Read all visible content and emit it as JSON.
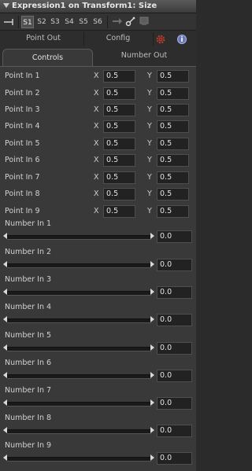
{
  "title": "Expression1 on Transform1: Size",
  "toolbar": {
    "slots": [
      "S1",
      "S2",
      "S3",
      "S4",
      "S5",
      "S6"
    ],
    "active_slot": "S1"
  },
  "tabs": {
    "top": [
      "Point Out",
      "Config"
    ],
    "sub": [
      "Controls",
      "Number Out"
    ]
  },
  "icons": {
    "gear": "gear-icon",
    "info": "info-icon",
    "info_glyph": "i"
  },
  "points": [
    {
      "label": "Point In 1",
      "x_label": "X",
      "x": "0.5",
      "y_label": "Y",
      "y": "0.5"
    },
    {
      "label": "Point In 2",
      "x_label": "X",
      "x": "0.5",
      "y_label": "Y",
      "y": "0.5"
    },
    {
      "label": "Point In 3",
      "x_label": "X",
      "x": "0.5",
      "y_label": "Y",
      "y": "0.5"
    },
    {
      "label": "Point In 4",
      "x_label": "X",
      "x": "0.5",
      "y_label": "Y",
      "y": "0.5"
    },
    {
      "label": "Point In 5",
      "x_label": "X",
      "x": "0.5",
      "y_label": "Y",
      "y": "0.5"
    },
    {
      "label": "Point In 6",
      "x_label": "X",
      "x": "0.5",
      "y_label": "Y",
      "y": "0.5"
    },
    {
      "label": "Point In 7",
      "x_label": "X",
      "x": "0.5",
      "y_label": "Y",
      "y": "0.5"
    },
    {
      "label": "Point In 8",
      "x_label": "X",
      "x": "0.5",
      "y_label": "Y",
      "y": "0.5"
    },
    {
      "label": "Point In 9",
      "x_label": "X",
      "x": "0.5",
      "y_label": "Y",
      "y": "0.5"
    }
  ],
  "numbers": [
    {
      "label": "Number In 1",
      "value": "0.0"
    },
    {
      "label": "Number In 2",
      "value": "0.0"
    },
    {
      "label": "Number In 3",
      "value": "0.0"
    },
    {
      "label": "Number In 4",
      "value": "0.0"
    },
    {
      "label": "Number In 5",
      "value": "0.0"
    },
    {
      "label": "Number In 6",
      "value": "0.0"
    },
    {
      "label": "Number In 7",
      "value": "0.0"
    },
    {
      "label": "Number In 8",
      "value": "0.0"
    },
    {
      "label": "Number In 9",
      "value": "0.0"
    }
  ],
  "colors": {
    "panel_bg": "#393939",
    "field_bg": "#222222",
    "info_accent": "#6b78b8",
    "gear_accent": "#c0392b"
  }
}
